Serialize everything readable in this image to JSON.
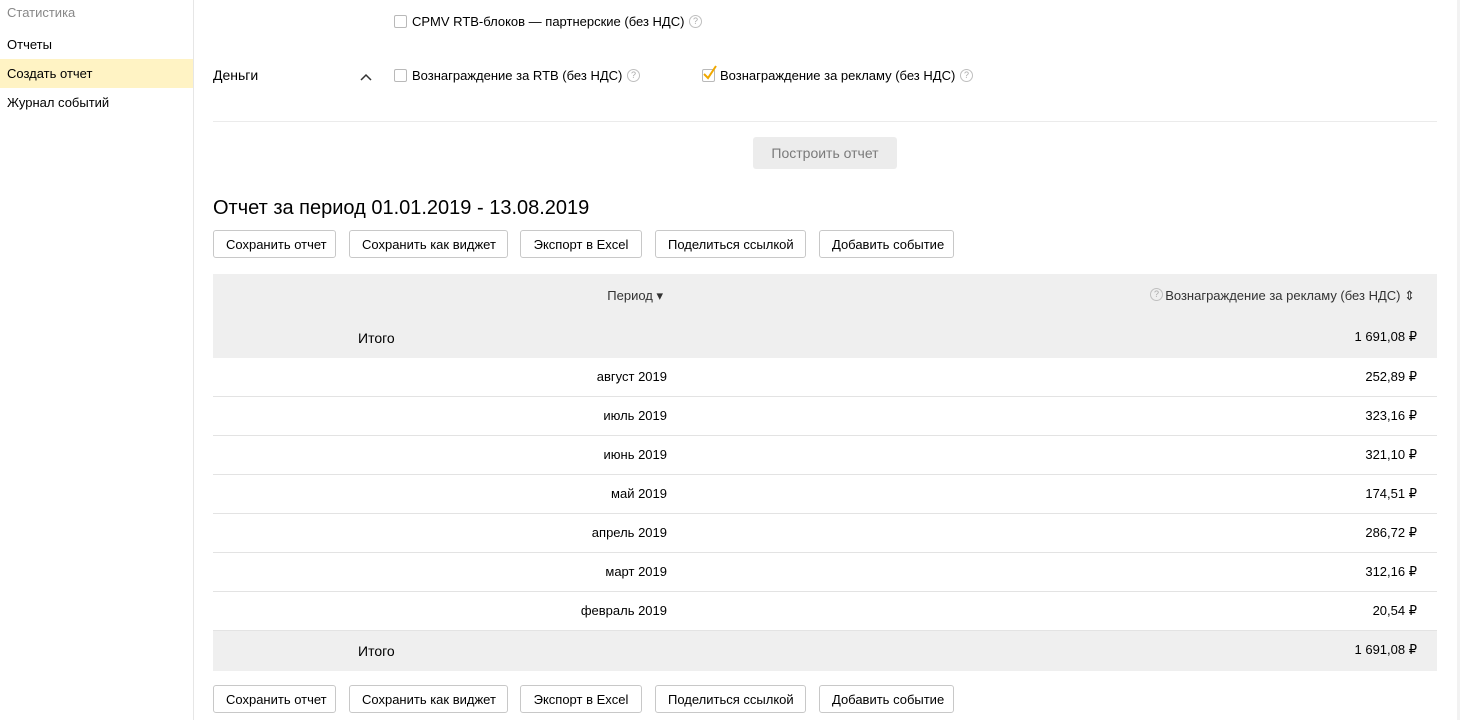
{
  "sidebar": {
    "header": "Статистика",
    "items": [
      {
        "label": "Отчеты"
      },
      {
        "label": "Создать отчет"
      },
      {
        "label": "Журнал событий"
      }
    ]
  },
  "filters": {
    "cpmv_label": "CPMV RTB-блоков — партнерские (без НДС)",
    "section_label": "Деньги",
    "rtb_reward_label": "Вознаграждение за RTB (без НДС)",
    "ad_reward_label": "Вознаграждение за рекламу (без НДС)",
    "help_glyph": "?"
  },
  "build_button": "Построить отчет",
  "report": {
    "title": "Отчет за период 01.01.2019 - 13.08.2019",
    "actions": {
      "save": "Сохранить отчет",
      "save_widget": "Сохранить как виджет",
      "export_excel": "Экспорт в Excel",
      "share_link": "Поделиться ссылкой",
      "add_event": "Добавить событие"
    },
    "table": {
      "col_period": "Период ▾",
      "col_value": "Вознаграждение за рекламу (без НДС) ⇕",
      "total_label": "Итого",
      "total_value": "1 691,08 ₽",
      "rows": [
        {
          "period": "август 2019",
          "value": "252,89 ₽"
        },
        {
          "period": "июль 2019",
          "value": "323,16 ₽"
        },
        {
          "period": "июнь 2019",
          "value": "321,10 ₽"
        },
        {
          "period": "май 2019",
          "value": "174,51 ₽"
        },
        {
          "period": "апрель 2019",
          "value": "286,72 ₽"
        },
        {
          "period": "март 2019",
          "value": "312,16 ₽"
        },
        {
          "period": "февраль 2019",
          "value": "20,54 ₽"
        }
      ]
    }
  },
  "colors": {
    "active_sidebar": "#fff3c4",
    "checkmark": "#f0a800",
    "table_header_bg": "#efefef"
  }
}
